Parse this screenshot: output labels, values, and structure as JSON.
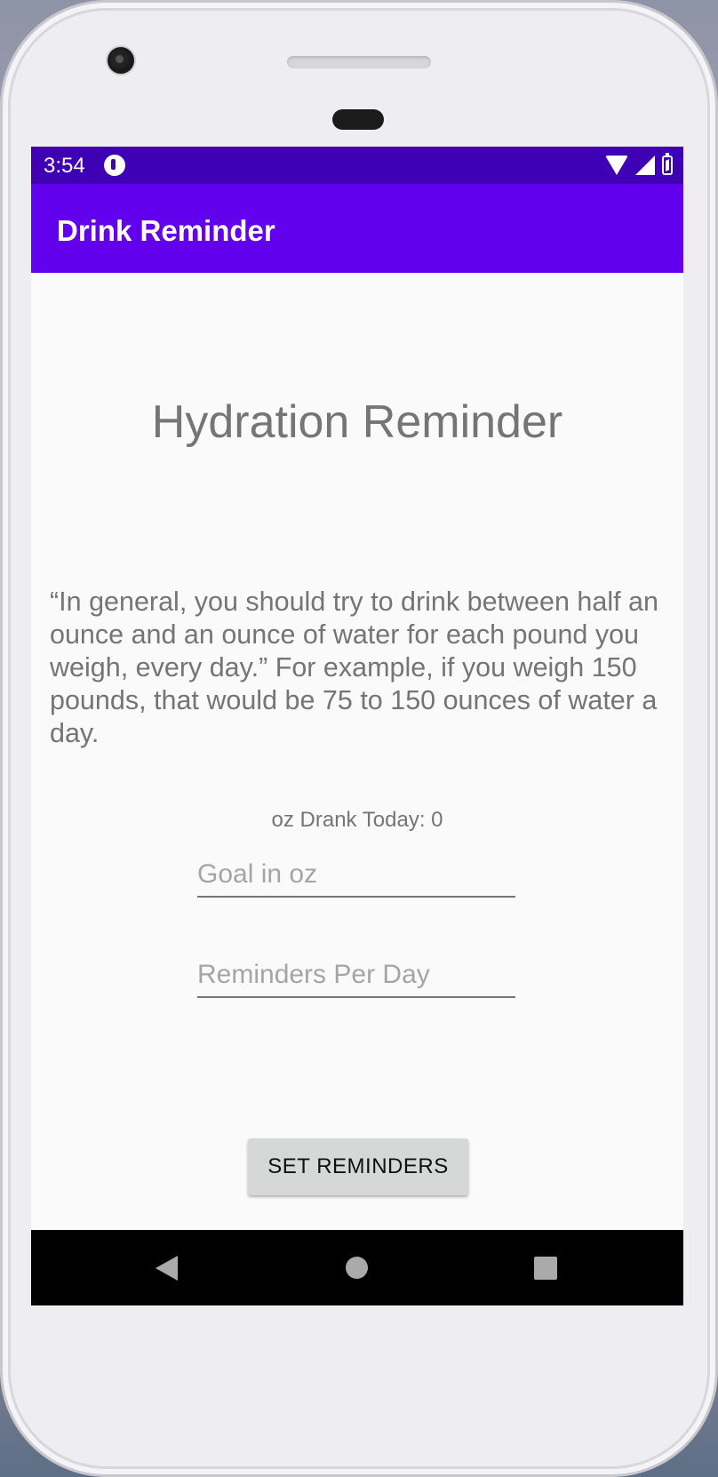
{
  "status_bar": {
    "time": "3:54",
    "icons": [
      "app-notification-icon",
      "wifi-icon",
      "cell-signal-icon",
      "battery-charging-icon"
    ]
  },
  "app_bar": {
    "title": "Drink Reminder",
    "color": "#6200ee"
  },
  "main": {
    "heading": "Hydration Reminder",
    "quote": "“In general, you should try to drink between half an ounce and an ounce of water for each pound you weigh, every day.” For example, if you weigh 150 pounds, that would be 75 to 150 ounces of water a day.",
    "oz_drank": "oz Drank Today: 0",
    "goal_field": {
      "placeholder": "Goal in oz",
      "value": ""
    },
    "reminders_field": {
      "placeholder": "Reminders Per Day",
      "value": ""
    },
    "set_button_label": "SET REMINDERS"
  },
  "nav_bar": {
    "icons": [
      "back-icon",
      "home-icon",
      "recents-icon"
    ]
  },
  "colors": {
    "status_bar": "#3f00b5",
    "accent": "#6200ee",
    "text_secondary": "#757575"
  }
}
